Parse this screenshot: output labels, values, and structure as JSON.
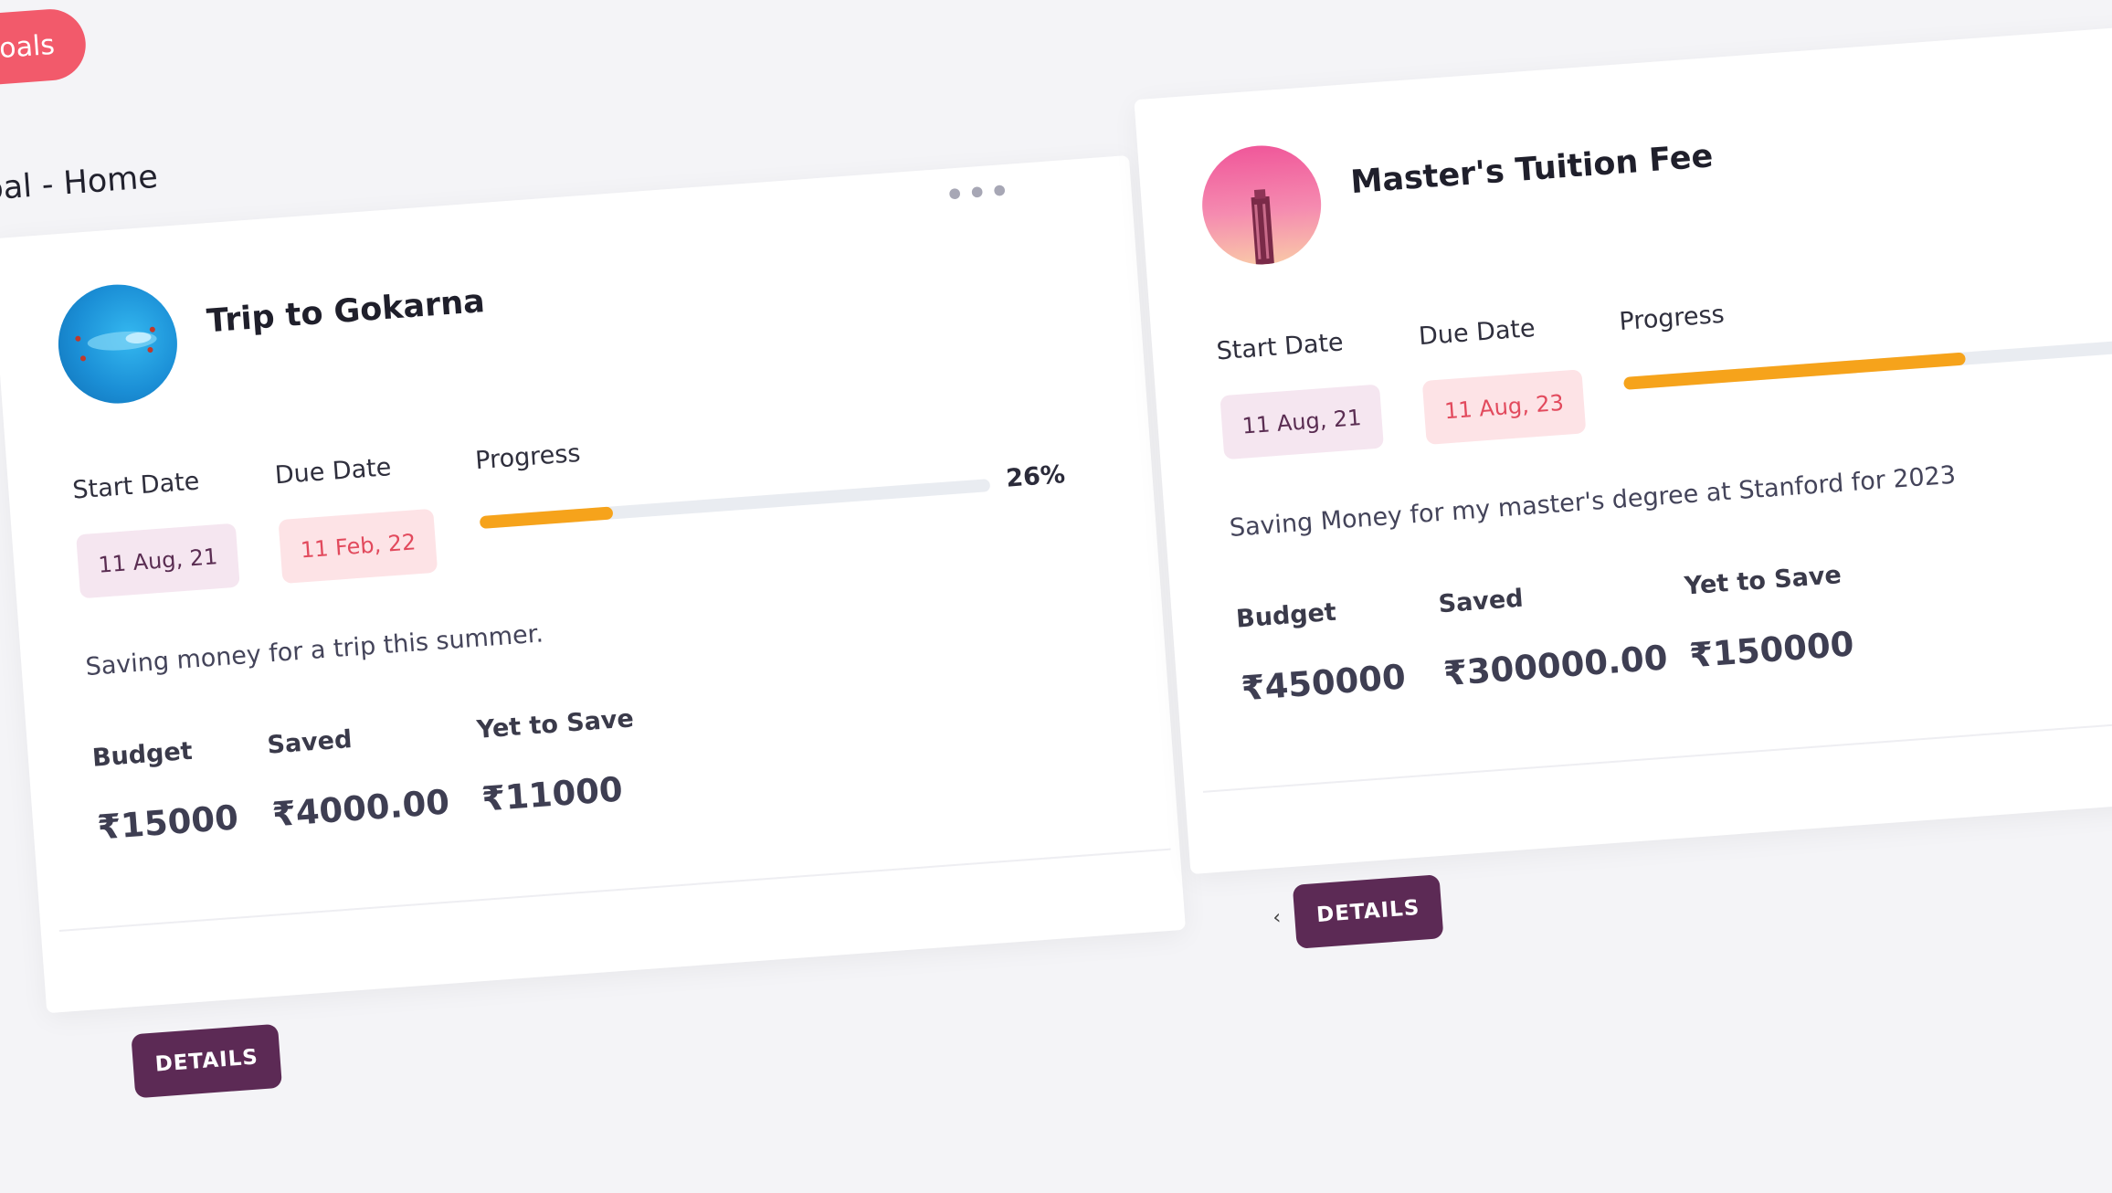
{
  "header": {
    "goals_tab": "Goals",
    "section_title": "Goal - Home"
  },
  "currency": "₹",
  "goals": [
    {
      "name": "Trip to Gokarna",
      "labels": {
        "start": "Start Date",
        "due": "Due Date",
        "progress": "Progress"
      },
      "start_date": "11 Aug, 21",
      "due_date": "11 Feb, 22",
      "progress_percent": 26,
      "progress_text": "26%",
      "description": "Saving money for a trip this summer.",
      "stats": [
        {
          "label": "Budget",
          "value": "₹15000"
        },
        {
          "label": "Saved",
          "value": "₹4000.00"
        },
        {
          "label": "Yet to Save",
          "value": "₹11000"
        }
      ],
      "details_label": "DETAILS",
      "avatar_icon": "beach-avatar-icon"
    },
    {
      "name": "Master's Tuition Fee",
      "labels": {
        "start": "Start Date",
        "due": "Due Date",
        "progress": "Progress"
      },
      "start_date": "11 Aug, 21",
      "due_date": "11 Aug, 23",
      "progress_percent": 67,
      "description": "Saving Money for my master's degree at Stanford for 2023",
      "stats": [
        {
          "label": "Budget",
          "value": "₹450000"
        },
        {
          "label": "Saved",
          "value": "₹300000.00"
        },
        {
          "label": "Yet to Save",
          "value": "₹150000"
        }
      ],
      "details_label": "DETAILS",
      "avatar_icon": "building-avatar-icon"
    }
  ],
  "colors": {
    "accent": "#f25a6b",
    "button": "#5c2a55",
    "progress": "#f6a31b"
  }
}
